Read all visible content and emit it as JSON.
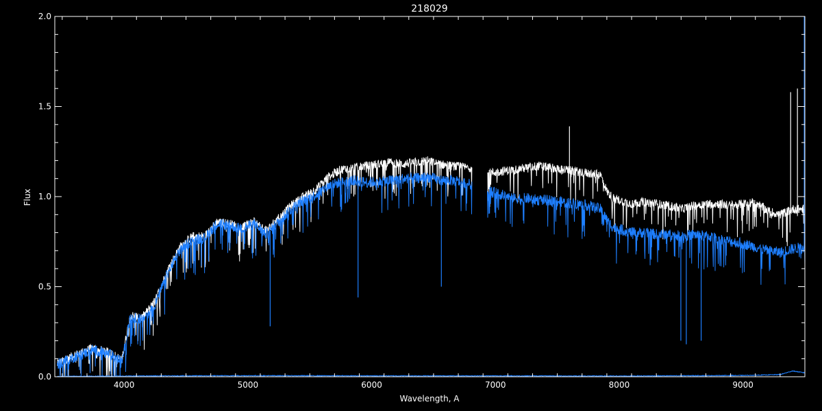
{
  "chart_data": {
    "type": "line",
    "title": "218029",
    "xlabel": "Wavelength, A",
    "ylabel": "Flux",
    "xlim": [
      3440,
      9500
    ],
    "ylim": [
      0,
      2.0
    ],
    "xticks": [
      {
        "value": 4000,
        "label": "4000"
      },
      {
        "value": 5000,
        "label": "5000"
      },
      {
        "value": 6000,
        "label": "6000"
      },
      {
        "value": 7000,
        "label": "7000"
      },
      {
        "value": 8000,
        "label": "8000"
      },
      {
        "value": 9000,
        "label": "9000"
      }
    ],
    "yticks": [
      {
        "value": 0.0,
        "label": "0.0"
      },
      {
        "value": 0.5,
        "label": "0.5"
      },
      {
        "value": 1.0,
        "label": "1.0"
      },
      {
        "value": 1.5,
        "label": "1.5"
      },
      {
        "value": 2.0,
        "label": "2.0"
      }
    ],
    "grid": false,
    "legend": "none",
    "colors": {
      "background": "#000000",
      "axes": "#ffffff",
      "series1": "#ffffff",
      "series2": "#1e7fff",
      "series3": "#1e7fff"
    },
    "series": [
      {
        "color": "#ffffff",
        "points": [
          [
            3460,
            0.07
          ],
          [
            3600,
            0.12
          ],
          [
            3750,
            0.16
          ],
          [
            3900,
            0.13
          ],
          [
            3980,
            0.09
          ],
          [
            4050,
            0.34
          ],
          [
            4150,
            0.33
          ],
          [
            4250,
            0.42
          ],
          [
            4350,
            0.59
          ],
          [
            4450,
            0.72
          ],
          [
            4550,
            0.78
          ],
          [
            4650,
            0.78
          ],
          [
            4750,
            0.86
          ],
          [
            4850,
            0.85
          ],
          [
            4950,
            0.83
          ],
          [
            5050,
            0.86
          ],
          [
            5150,
            0.81
          ],
          [
            5250,
            0.88
          ],
          [
            5350,
            0.95
          ],
          [
            5450,
            1.0
          ],
          [
            5550,
            1.04
          ],
          [
            5650,
            1.11
          ],
          [
            5750,
            1.15
          ],
          [
            5850,
            1.16
          ],
          [
            5950,
            1.17
          ],
          [
            6050,
            1.18
          ],
          [
            6150,
            1.19
          ],
          [
            6250,
            1.18
          ],
          [
            6350,
            1.19
          ],
          [
            6450,
            1.2
          ],
          [
            6550,
            1.18
          ],
          [
            6650,
            1.17
          ],
          [
            6800,
            1.16
          ],
          [
            6950,
            1.13
          ],
          [
            7050,
            1.14
          ],
          [
            7150,
            1.15
          ],
          [
            7250,
            1.16
          ],
          [
            7350,
            1.17
          ],
          [
            7450,
            1.16
          ],
          [
            7550,
            1.15
          ],
          [
            7650,
            1.14
          ],
          [
            7750,
            1.13
          ],
          [
            7850,
            1.12
          ],
          [
            7900,
            1.03
          ],
          [
            7950,
            0.99
          ],
          [
            8000,
            0.98
          ],
          [
            8100,
            0.96
          ],
          [
            8200,
            0.97
          ],
          [
            8300,
            0.96
          ],
          [
            8400,
            0.95
          ],
          [
            8500,
            0.93
          ],
          [
            8600,
            0.95
          ],
          [
            8700,
            0.96
          ],
          [
            8800,
            0.96
          ],
          [
            8900,
            0.95
          ],
          [
            9000,
            0.96
          ],
          [
            9100,
            0.97
          ],
          [
            9200,
            0.92
          ],
          [
            9300,
            0.9
          ],
          [
            9400,
            0.93
          ],
          [
            9500,
            0.93
          ]
        ],
        "spikes": [
          [
            7598,
            1.39
          ],
          [
            9385,
            1.58
          ],
          [
            9440,
            1.6
          ]
        ]
      },
      {
        "color": "#1e7fff",
        "points": [
          [
            3460,
            0.07
          ],
          [
            3600,
            0.11
          ],
          [
            3750,
            0.15
          ],
          [
            3900,
            0.12
          ],
          [
            3980,
            0.08
          ],
          [
            4050,
            0.33
          ],
          [
            4150,
            0.32
          ],
          [
            4250,
            0.4
          ],
          [
            4350,
            0.57
          ],
          [
            4450,
            0.7
          ],
          [
            4550,
            0.76
          ],
          [
            4650,
            0.77
          ],
          [
            4750,
            0.85
          ],
          [
            4850,
            0.84
          ],
          [
            4950,
            0.82
          ],
          [
            5050,
            0.85
          ],
          [
            5150,
            0.79
          ],
          [
            5250,
            0.86
          ],
          [
            5350,
            0.93
          ],
          [
            5450,
            0.98
          ],
          [
            5550,
            1.01
          ],
          [
            5650,
            1.06
          ],
          [
            5750,
            1.08
          ],
          [
            5850,
            1.09
          ],
          [
            5950,
            1.08
          ],
          [
            6050,
            1.08
          ],
          [
            6150,
            1.09
          ],
          [
            6250,
            1.1
          ],
          [
            6350,
            1.1
          ],
          [
            6450,
            1.11
          ],
          [
            6550,
            1.09
          ],
          [
            6650,
            1.09
          ],
          [
            6800,
            1.07
          ],
          [
            6950,
            1.03
          ],
          [
            7050,
            1.01
          ],
          [
            7150,
            0.99
          ],
          [
            7250,
            0.99
          ],
          [
            7350,
            0.98
          ],
          [
            7450,
            0.98
          ],
          [
            7550,
            0.97
          ],
          [
            7650,
            0.96
          ],
          [
            7750,
            0.95
          ],
          [
            7850,
            0.93
          ],
          [
            7900,
            0.87
          ],
          [
            7950,
            0.83
          ],
          [
            8000,
            0.82
          ],
          [
            8100,
            0.8
          ],
          [
            8200,
            0.8
          ],
          [
            8300,
            0.79
          ],
          [
            8400,
            0.79
          ],
          [
            8500,
            0.78
          ],
          [
            8600,
            0.79
          ],
          [
            8700,
            0.78
          ],
          [
            8800,
            0.77
          ],
          [
            8900,
            0.75
          ],
          [
            9000,
            0.74
          ],
          [
            9100,
            0.72
          ],
          [
            9200,
            0.7
          ],
          [
            9300,
            0.69
          ],
          [
            9400,
            0.71
          ],
          [
            9500,
            0.72
          ]
        ],
        "spikes": [
          [
            5180,
            0.28
          ],
          [
            5890,
            0.44
          ],
          [
            6563,
            0.5
          ],
          [
            8498,
            0.2
          ],
          [
            8542,
            0.18
          ],
          [
            8662,
            0.2
          ],
          [
            9495,
            2.0
          ]
        ]
      },
      {
        "color": "#1e7fff",
        "points": [
          [
            3460,
            0.0
          ],
          [
            4000,
            0.002
          ],
          [
            5000,
            0.004
          ],
          [
            6000,
            0.003
          ],
          [
            7000,
            0.003
          ],
          [
            8000,
            0.002
          ],
          [
            9000,
            0.005
          ],
          [
            9300,
            0.01
          ],
          [
            9400,
            0.03
          ],
          [
            9500,
            0.02
          ]
        ]
      }
    ]
  }
}
